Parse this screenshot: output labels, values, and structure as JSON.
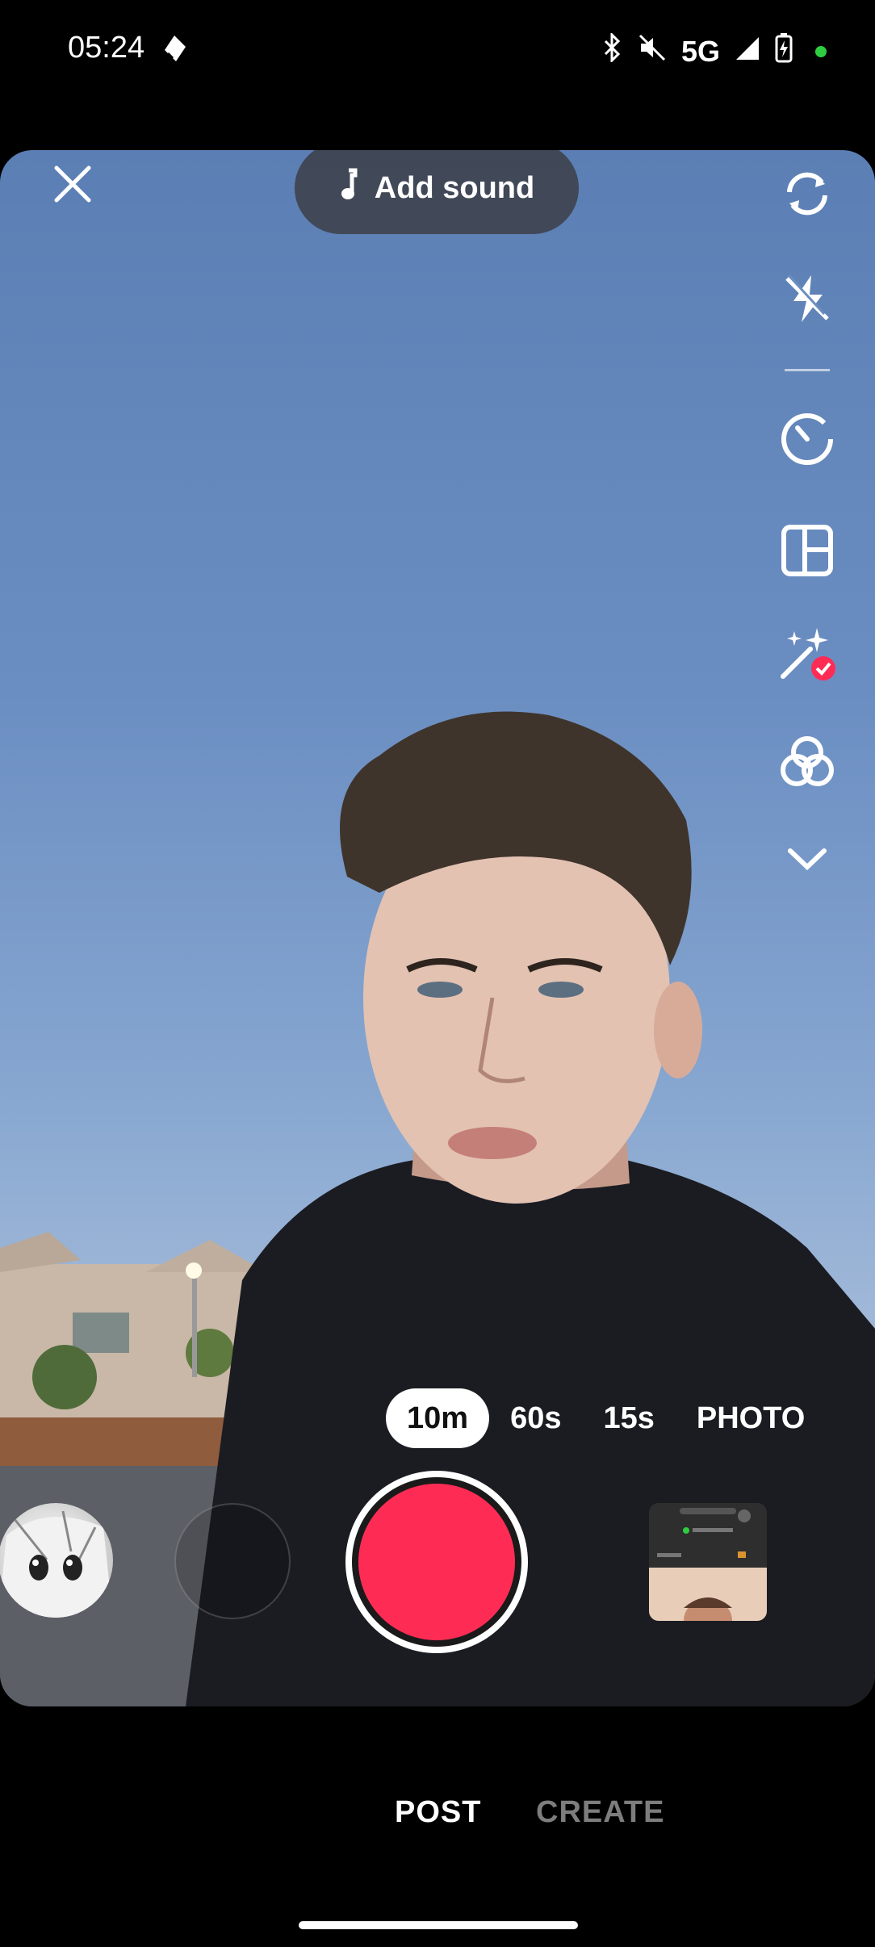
{
  "status_bar": {
    "time": "05:24",
    "network": "5G",
    "icons": [
      "data-saver-icon",
      "bluetooth-icon",
      "mute-icon",
      "signal-icon",
      "battery-charging-icon",
      "privacy-indicator-dot"
    ]
  },
  "camera": {
    "add_sound_label": "Add sound",
    "durations": [
      "10m",
      "60s",
      "15s",
      "PHOTO"
    ],
    "selected_duration": "10m",
    "side_tools": [
      "flip-camera-icon",
      "flash-off-icon",
      "timer-icon",
      "layout-icon",
      "effects-wand-icon",
      "filters-icon",
      "more-chevron-icon"
    ]
  },
  "bottom_tabs": {
    "post": "POST",
    "create": "CREATE"
  },
  "colors": {
    "record": "#fe2c55",
    "sky": "#6b8ec2"
  }
}
